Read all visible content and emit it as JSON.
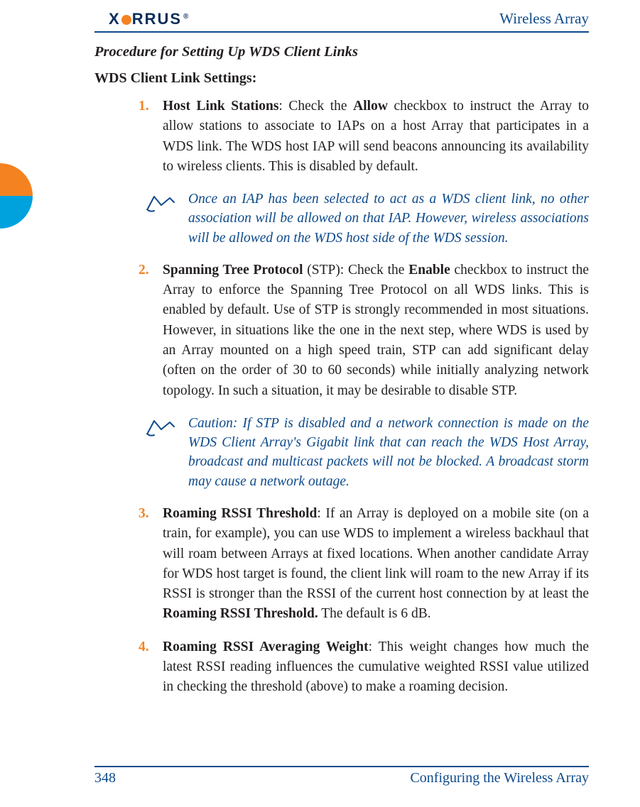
{
  "header": {
    "logo_text": "X",
    "logo_rest": "RRUS",
    "logo_reg": "®",
    "doc_title": "Wireless Array"
  },
  "section_title": "Procedure for Setting Up WDS Client Links",
  "subhead": "WDS Client Link Settings:",
  "steps": [
    {
      "num": "1.",
      "lead": "Host Link Stations",
      "tail_pre": ": Check the ",
      "bold_inline": "Allow",
      "tail_post": " checkbox to instruct the Array to allow stations to associate to IAPs on a host Array that participates in a WDS link. The WDS host IAP will send beacons announcing its availability to wireless clients. This is disabled by default."
    },
    {
      "num": "2.",
      "lead": "Spanning Tree Protocol",
      "tail_pre": " (STP): Check the ",
      "bold_inline": "Enable",
      "tail_post": " checkbox to instruct the Array to enforce the Spanning Tree Protocol on all WDS links. This is enabled by default. Use of STP is strongly recommended in most situations. However, in situations like the one in the next step, where WDS is used by an Array mounted on a high speed train, STP can add significant delay (often on the order of 30 to 60 seconds) while initially analyzing network topology. In such a situation, it may be desirable to disable STP."
    },
    {
      "num": "3.",
      "lead": "Roaming RSSI Threshold",
      "tail_pre": ": If an Array is deployed on a mobile site (on a train, for example), you can use WDS to implement a wireless backhaul that will roam between Arrays at fixed locations. When another candidate Array for WDS host target is found, the client link will roam to the new Array if its RSSI is stronger than the RSSI of the current host connection by at least the ",
      "bold_inline": "Roaming RSSI Threshold.",
      "tail_post": " The default is 6 dB."
    },
    {
      "num": "4.",
      "lead": "Roaming RSSI Averaging Weight",
      "tail_pre": ": This weight changes how much the latest RSSI reading influences the cumulative weighted RSSI value utilized in checking the threshold (above) to make a roaming decision.",
      "bold_inline": "",
      "tail_post": ""
    }
  ],
  "notes": [
    {
      "text": "Once an IAP has been selected to act as a WDS client link, no other association will be allowed on that IAP. However, wireless associations will be allowed on the WDS host side of the WDS session."
    },
    {
      "text": "Caution: If STP is disabled and a network connection is made on the WDS Client Array's Gigabit link that can reach the WDS Host Array, broadcast and multicast packets will not be blocked. A broadcast storm may cause a network outage."
    }
  ],
  "footer": {
    "page": "348",
    "section": "Configuring the Wireless Array"
  }
}
